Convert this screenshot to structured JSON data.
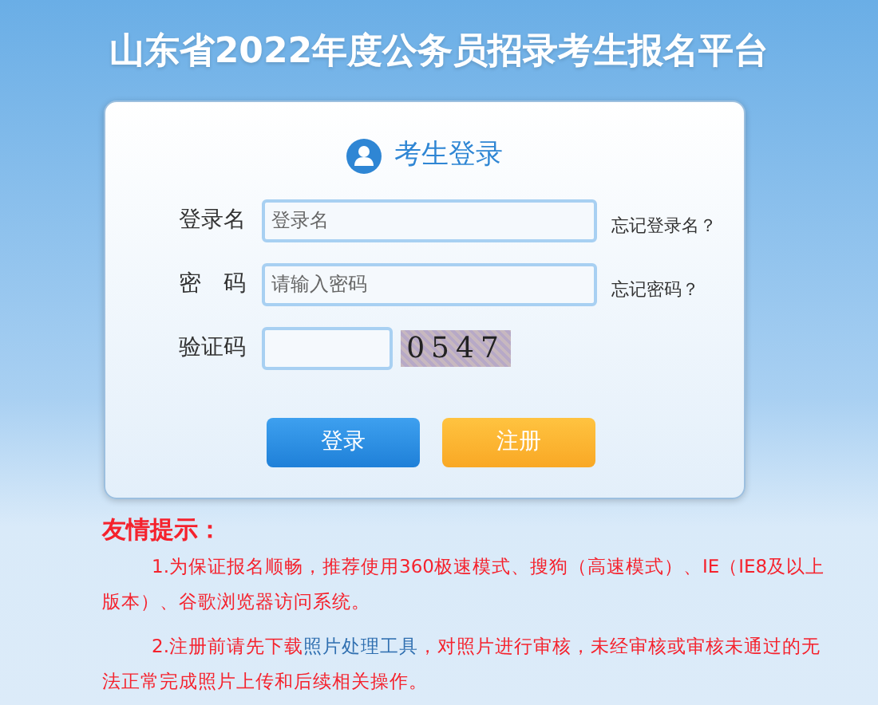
{
  "title": "山东省2022年度公务员招录考生报名平台",
  "login_card": {
    "heading": "考生登录",
    "fields": [
      {
        "label": "登录名",
        "placeholder": "登录名",
        "link": "忘记登录名？"
      },
      {
        "label": "密　码",
        "placeholder": "请输入密码",
        "link": "忘记密码？"
      },
      {
        "label": "验证码",
        "kind": "captcha",
        "captcha": "0547"
      }
    ],
    "buttons": [
      {
        "label": "登录",
        "kind": "primary"
      },
      {
        "label": "注册",
        "kind": "secondary"
      }
    ]
  },
  "tips": {
    "title": "友情提示：",
    "items": [
      {
        "text": "1.为保证报名顺畅，推荐使用360极速模式、搜狗（高速模式）、IE（IE8及以上版本）、谷歌浏览器访问系统。"
      },
      {
        "text": "2.注册前请先下载",
        "link": "照片处理工具",
        "after": "，对照片进行审核，未经审核或审核未通过的无法正常完成照片上传和后续相关操作。"
      }
    ]
  }
}
